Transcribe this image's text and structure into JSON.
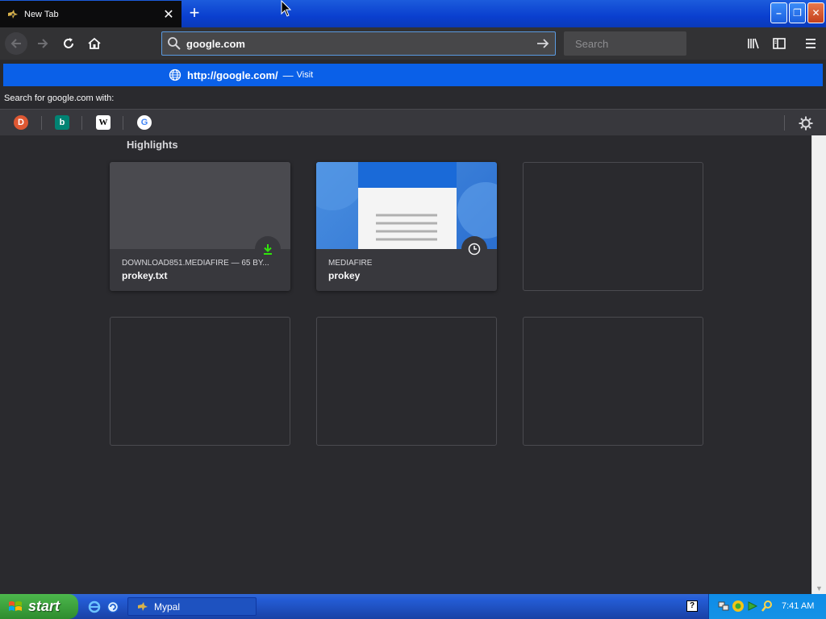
{
  "tab": {
    "title": "New Tab",
    "close_label": "✕",
    "new_tab_label": "+"
  },
  "window": {
    "min_label": "–",
    "max_label": "❐",
    "close_label": "✕"
  },
  "urlbar": {
    "value": "google.com"
  },
  "searchbar": {
    "placeholder": "Search"
  },
  "suggestion": {
    "url": "http://google.com/",
    "separator": "—",
    "action": "Visit"
  },
  "oneoff": {
    "label": "Search for google.com with:",
    "engines": [
      {
        "name": "duckduckgo",
        "glyph": "D",
        "color": "#de5833"
      },
      {
        "name": "bing",
        "glyph": "b",
        "color": "#008373"
      },
      {
        "name": "wikipedia",
        "glyph": "W",
        "color": "#ffffff"
      },
      {
        "name": "google",
        "glyph": "G",
        "color": "#4285f4"
      }
    ]
  },
  "highlights": {
    "title": "Highlights",
    "cards": [
      {
        "context": "DOWNLOAD851.MEDIAFIRE — 65 BY...",
        "title": "prokey.txt",
        "badge": "download-icon"
      },
      {
        "context": "MEDIAFIRE",
        "title": "prokey",
        "badge": "clock-icon"
      }
    ]
  },
  "taskbar": {
    "start_label": "start",
    "task_label": "Mypal",
    "clock": "7:41 AM",
    "help_label": "?"
  }
}
